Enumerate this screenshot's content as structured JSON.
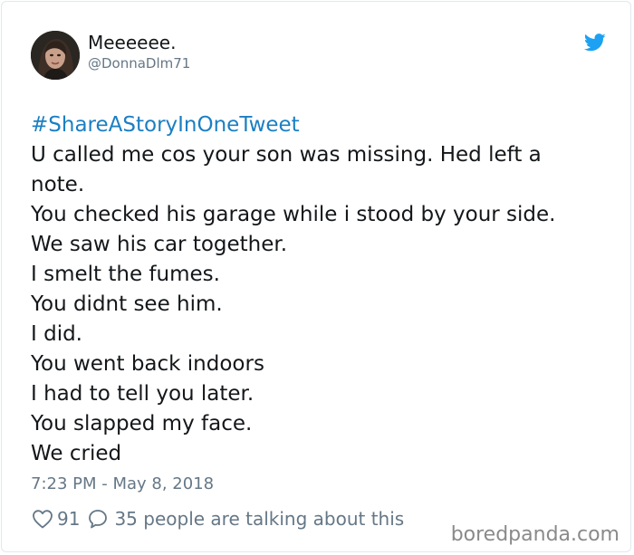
{
  "tweet": {
    "display_name": "Meeeeee.",
    "handle": "@DonnaDlm71",
    "hashtag": "#ShareAStoryInOneTweet",
    "lines": [
      "U called me cos your son was missing. Hed left a",
      "note.",
      "You checked his garage while i stood by your side.",
      "We saw his car together.",
      "I smelt the fumes.",
      "You didnt see him.",
      "I did.",
      "You went back indoors",
      "I had to tell you later.",
      "You slapped my face.",
      "We cried"
    ],
    "timestamp": "7:23 PM - May 8, 2018",
    "like_count": "91",
    "talking_text": "35 people are talking about this"
  },
  "watermark": "boredpanda.com",
  "colors": {
    "twitter_blue": "#1da1f2",
    "hashtag": "#1b7fc3",
    "meta_gray": "#657786",
    "text": "#14171a"
  },
  "icons": {
    "brand": "twitter-bird-icon",
    "like": "heart-icon",
    "reply": "speech-bubble-icon"
  }
}
